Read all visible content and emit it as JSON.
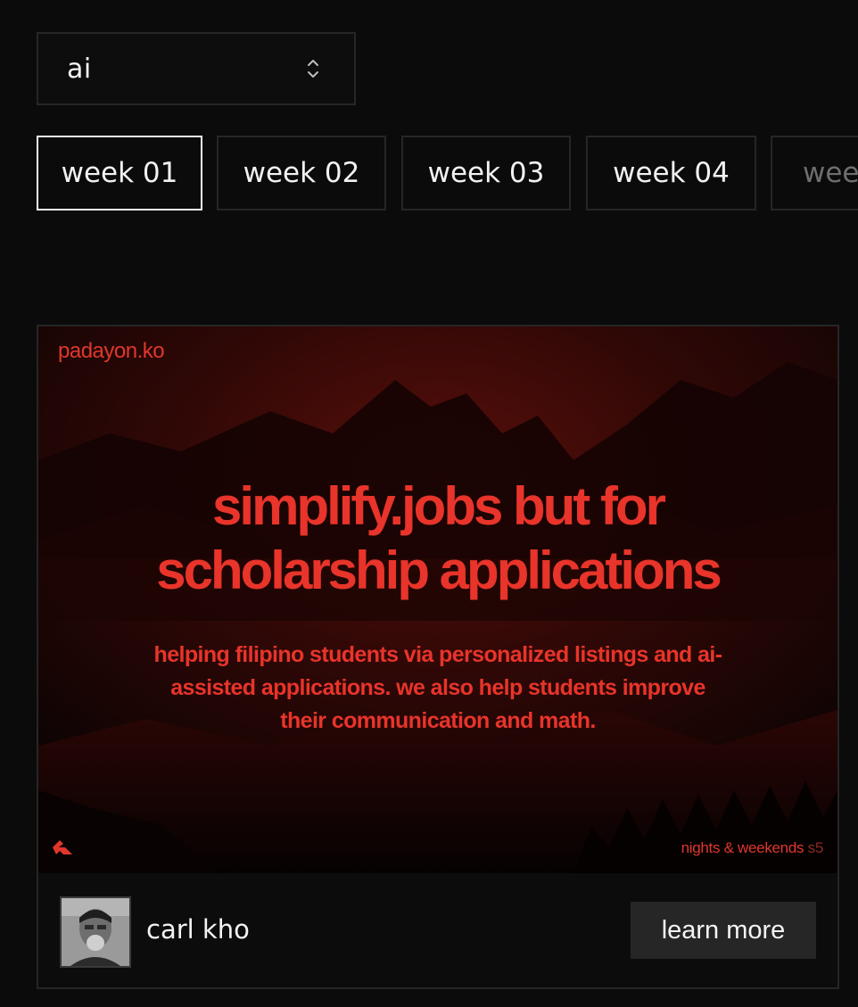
{
  "filter": {
    "selected": "ai",
    "icon": "chevron-up-down-icon"
  },
  "weeks": [
    "week 01",
    "week 02",
    "week 03",
    "week 04",
    "wee"
  ],
  "project": {
    "brand": "padayon.ko",
    "headline_line1": "simplify.jobs but for",
    "headline_line2": "scholarship applications",
    "description_line1": "helping filipino students via personalized listings and ai-",
    "description_line2": "assisted applications. we also help students improve",
    "description_line3": "their communication and math.",
    "program": "nights & weekends",
    "season": "s5",
    "author": "carl kho",
    "cta_label": "learn more"
  },
  "colors": {
    "background": "#0b0b0b",
    "accent_red": "#e8342a",
    "border": "#262626",
    "button_bg": "#262626"
  }
}
